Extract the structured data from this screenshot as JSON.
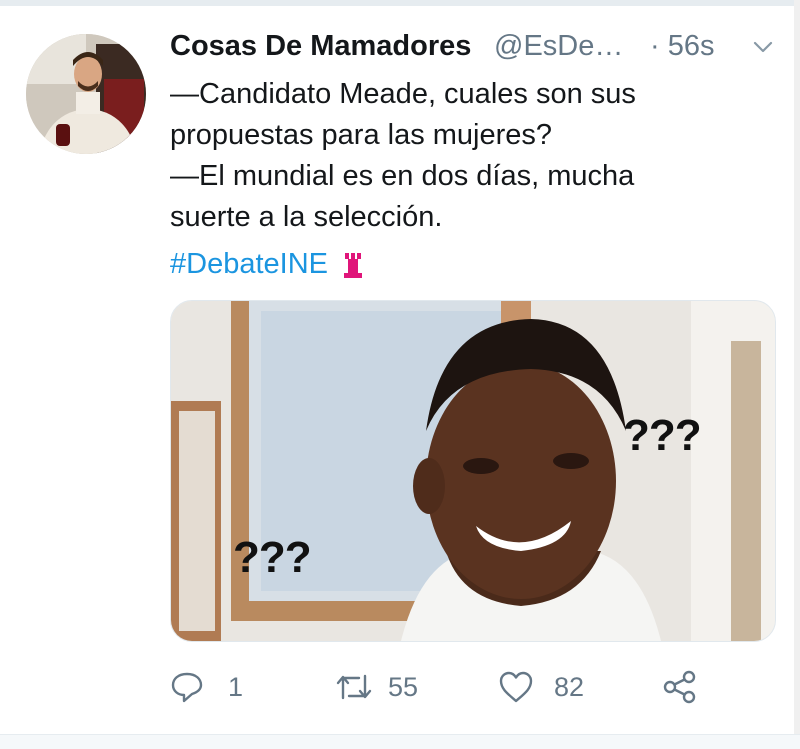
{
  "tweet": {
    "display_name": "Cosas De Mamadores",
    "handle": "@EsDe…",
    "time": "· 56s",
    "text_lines": [
      "—Candidato Meade, cuales son sus",
      "propuestas para las mujeres?",
      "—El mundial es en dos días, mucha",
      "suerte a la selección."
    ],
    "hashtag": "#DebateINE",
    "hashtag_emoji": "ine-pink-emblem-icon",
    "media": {
      "overlay_text_1": "???",
      "overlay_text_2": "???"
    }
  },
  "actions": {
    "reply_count": "1",
    "retweet_count": "55",
    "like_count": "82"
  },
  "colors": {
    "text": "#14171a",
    "secondary": "#657786",
    "link": "#1b95e0",
    "emblem": "#e0157a"
  }
}
